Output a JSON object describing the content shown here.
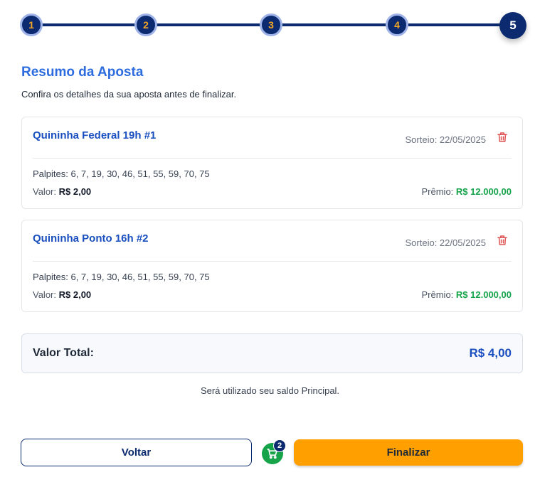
{
  "stepper": {
    "steps": [
      "1",
      "2",
      "3",
      "4",
      "5"
    ],
    "active": "5"
  },
  "summary": {
    "title": "Resumo da Aposta",
    "subtitle": "Confira os detalhes da sua aposta antes de finalizar."
  },
  "bets": [
    {
      "name": "Quininha Federal 19h #1",
      "draw_label": "Sorteio: 22/05/2025",
      "guesses_label": "Palpites: 6, 7, 19, 30, 46, 51, 55, 59, 70, 75",
      "value_label": "Valor:",
      "value": "R$ 2,00",
      "prize_label": "Prêmio:",
      "prize": "R$ 12.000,00"
    },
    {
      "name": "Quininha Ponto 16h #2",
      "draw_label": "Sorteio: 22/05/2025",
      "guesses_label": "Palpites: 6, 7, 19, 30, 46, 51, 55, 59, 70, 75",
      "value_label": "Valor:",
      "value": "R$ 2,00",
      "prize_label": "Prêmio:",
      "prize": "R$ 12.000,00"
    }
  ],
  "total": {
    "label": "Valor Total:",
    "value": "R$ 4,00"
  },
  "note": "Será utilizado seu saldo Principal.",
  "actions": {
    "back_label": "Voltar",
    "finish_label": "Finalizar",
    "cart_count": "2",
    "cart_icon": "cart-icon",
    "delete_icon": "trash-icon"
  },
  "colors": {
    "primary_navy": "#0b2a6f",
    "link_blue": "#1a4fbf",
    "title_blue": "#2d6cdf",
    "prize_green": "#16a34a",
    "finish_orange": "#ffa000",
    "delete_red": "#e05252"
  }
}
